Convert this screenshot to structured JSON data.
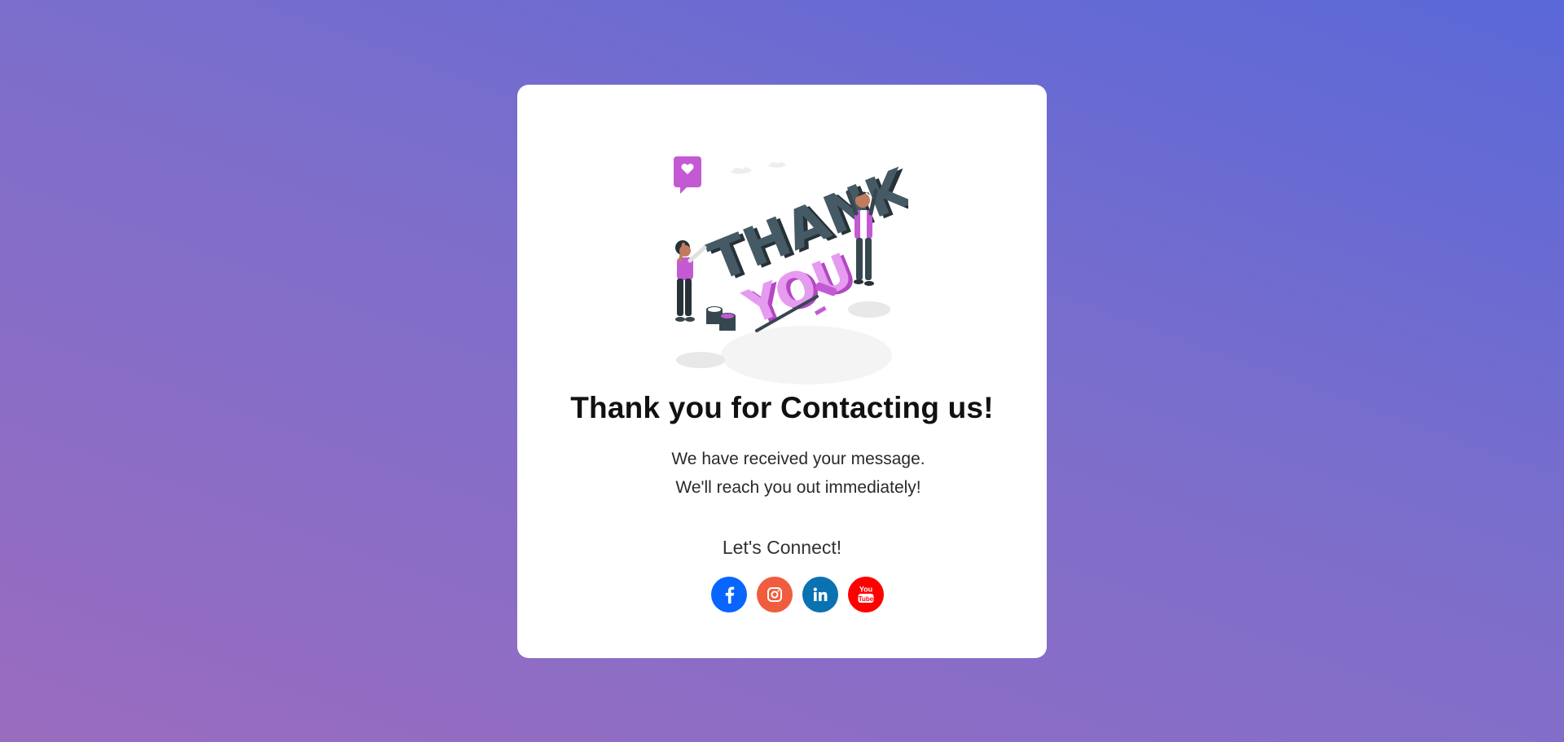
{
  "card": {
    "title": "Thank you for Contacting us!",
    "message_line1": "We have received your message.",
    "message_line2": "We'll reach you out immediately!",
    "connect_label": "Let's Connect!"
  },
  "illustration": {
    "word_top": "THANK",
    "word_bottom": "YOU"
  },
  "socials": [
    {
      "name": "facebook",
      "icon": "facebook-icon",
      "color": "#0866ff"
    },
    {
      "name": "instagram",
      "icon": "instagram-icon",
      "color": "#ef5d3e"
    },
    {
      "name": "linkedin",
      "icon": "linkedin-icon",
      "color": "#0a72b1"
    },
    {
      "name": "youtube",
      "icon": "youtube-icon",
      "color": "#ff0000"
    }
  ],
  "colors": {
    "background_top": "#5a68d8",
    "background_bottom": "#9a6cc0",
    "accent_pink": "#c45ad3",
    "letter_dark": "#37474f"
  }
}
